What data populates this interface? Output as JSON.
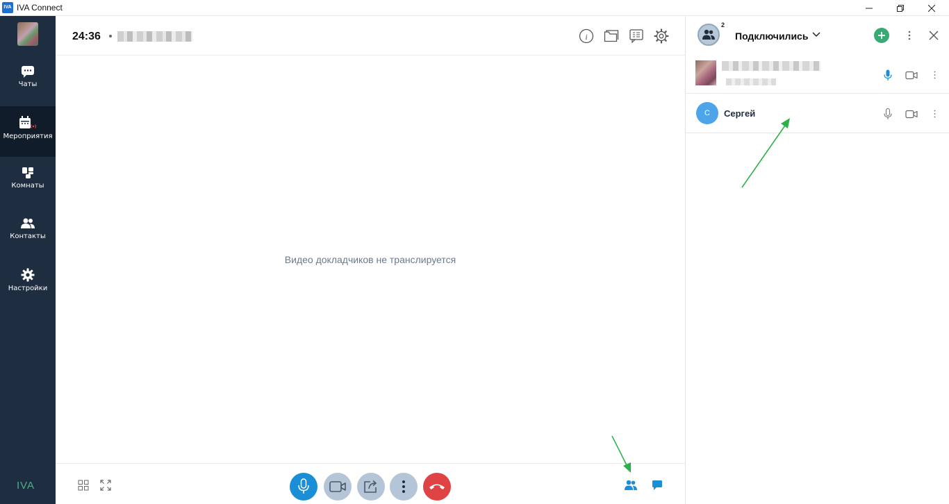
{
  "window": {
    "logo_text": "IVA",
    "title": "IVA Connect"
  },
  "sidebar": {
    "brand": "IVA",
    "items": [
      {
        "label": "Чаты",
        "icon": "chat-icon"
      },
      {
        "label": "Мероприятия",
        "icon": "calendar-live-icon",
        "active": true
      },
      {
        "label": "Комнаты",
        "icon": "rooms-icon"
      },
      {
        "label": "Контакты",
        "icon": "contacts-icon"
      },
      {
        "label": "Настройки",
        "icon": "gear-icon"
      }
    ]
  },
  "meeting": {
    "timer": "24:36",
    "empty_message": "Видео докладчиков не транслируется",
    "header_icons": [
      "info-icon",
      "folder-icon",
      "list-icon",
      "gear-icon"
    ],
    "controls": [
      "microphone-icon",
      "camera-icon",
      "share-screen-icon",
      "more-icon",
      "hang-up-icon"
    ],
    "bottom_left_icons": [
      "grid-layout-icon",
      "fullscreen-icon"
    ],
    "bottom_right_icons": [
      "participants-icon",
      "chat-icon"
    ]
  },
  "participants_panel": {
    "title": "Подключились",
    "count": "2",
    "participants": [
      {
        "name": "",
        "mic_active": true
      },
      {
        "name": "Сергей",
        "initial": "С",
        "mic_active": false
      }
    ]
  },
  "colors": {
    "sidebar_bg": "#1f2d40",
    "accent_blue": "#1a8ed6",
    "hangup_red": "#e04343",
    "add_green": "#3aaa74",
    "annotation_arrow": "#2db04a"
  }
}
